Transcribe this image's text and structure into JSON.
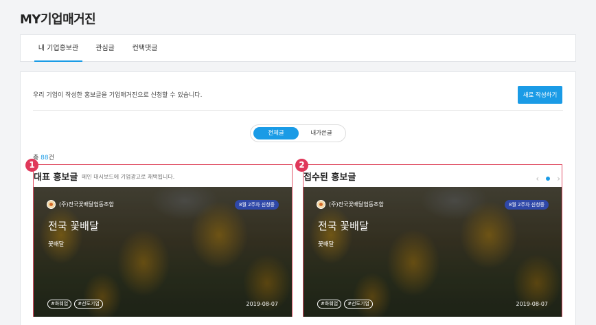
{
  "page": {
    "title": "MY기업매거진"
  },
  "tabs": [
    {
      "label": "내 기업홍보관"
    },
    {
      "label": "관심글"
    },
    {
      "label": "컨택댓글"
    }
  ],
  "intro": {
    "text": "우리 기업이 작성한 홍보글을 기업매거진으로 신청할 수 있습니다.",
    "write_button": "새로 작성하기"
  },
  "filter": {
    "all": "전체글",
    "mine": "내가쓴글"
  },
  "total": {
    "prefix": "총 ",
    "count": "88",
    "suffix": "건"
  },
  "sections": [
    {
      "badge": "1",
      "title": "대표 홍보글",
      "desc": "메인 대시보드에 기업광고로 채택됩니다.",
      "card": {
        "company": "(주)전국꽃배달협동조합",
        "tag": "8월 2주차 신청중",
        "title": "전국 꽃배달",
        "subtitle": "꽃배달",
        "hashtags": [
          "#화훼업",
          "#선도기업"
        ],
        "date": "2019-08-07"
      }
    },
    {
      "badge": "2",
      "title": "접수된 홍보글",
      "card": {
        "company": "(주)전국꽃배달협동조합",
        "tag": "8월 2주차 신청중",
        "title": "전국 꽃배달",
        "subtitle": "꽃배달",
        "hashtags": [
          "#화훼업",
          "#선도기업"
        ],
        "date": "2019-08-07"
      }
    }
  ],
  "colors": {
    "accent": "#1a9be6",
    "highlight": "#e0385a",
    "tag": "#2f48a8"
  },
  "icons": {
    "prev": "chevron-left-icon",
    "next": "chevron-right-icon"
  }
}
